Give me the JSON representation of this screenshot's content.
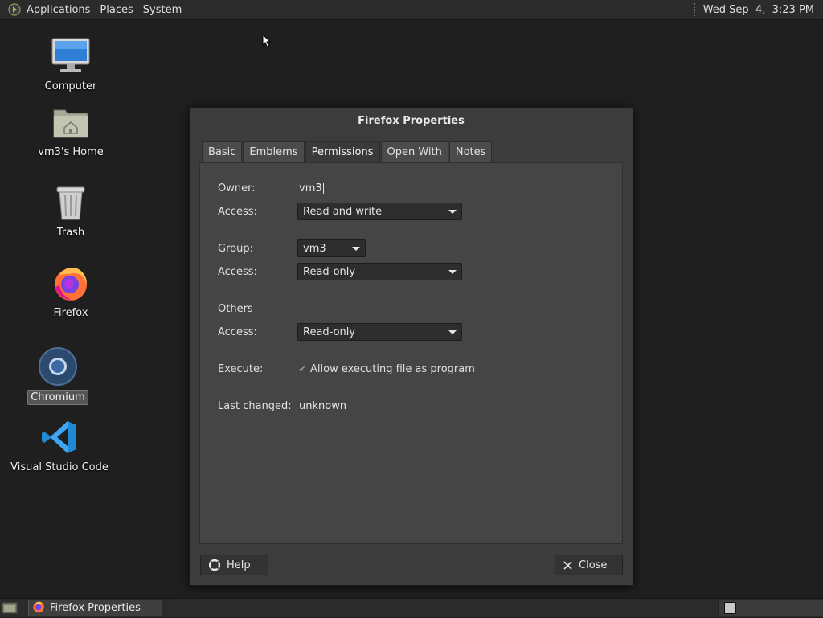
{
  "top_panel": {
    "menus": [
      "Applications",
      "Places",
      "System"
    ],
    "clock": "Wed Sep  4,  3:23 PM"
  },
  "desktop": {
    "icons": [
      {
        "label": "Computer",
        "icon": "computer-icon"
      },
      {
        "label": "vm3's Home",
        "icon": "home-folder-icon"
      },
      {
        "label": "Trash",
        "icon": "trash-icon"
      },
      {
        "label": "Firefox",
        "icon": "firefox-icon"
      },
      {
        "label": "Chromium",
        "icon": "chromium-icon",
        "selected": true
      },
      {
        "label": "Visual Studio Code",
        "icon": "vscode-icon"
      }
    ]
  },
  "dialog": {
    "title": "Firefox Properties",
    "tabs": [
      "Basic",
      "Emblems",
      "Permissions",
      "Open With",
      "Notes"
    ],
    "active_tab": "Permissions",
    "permissions": {
      "owner_label": "Owner:",
      "owner_value": "vm3",
      "owner_access_label": "Access:",
      "owner_access_value": "Read and write",
      "group_label": "Group:",
      "group_value": "vm3",
      "group_access_label": "Access:",
      "group_access_value": "Read-only",
      "others_label": "Others",
      "others_access_label": "Access:",
      "others_access_value": "Read-only",
      "execute_label": "Execute:",
      "execute_checkbox_label": "Allow executing file as program",
      "execute_checked": true,
      "last_changed_label": "Last changed:",
      "last_changed_value": "unknown"
    },
    "help_button": "Help",
    "close_button": "Close"
  },
  "bottom_panel": {
    "task_label": "Firefox Properties"
  },
  "colors": {
    "desktop_bg": "#1f1f1f",
    "panel_bg": "#2b2b2b",
    "dialog_bg": "#3c3c3c",
    "tab_panel_bg": "#454545"
  }
}
